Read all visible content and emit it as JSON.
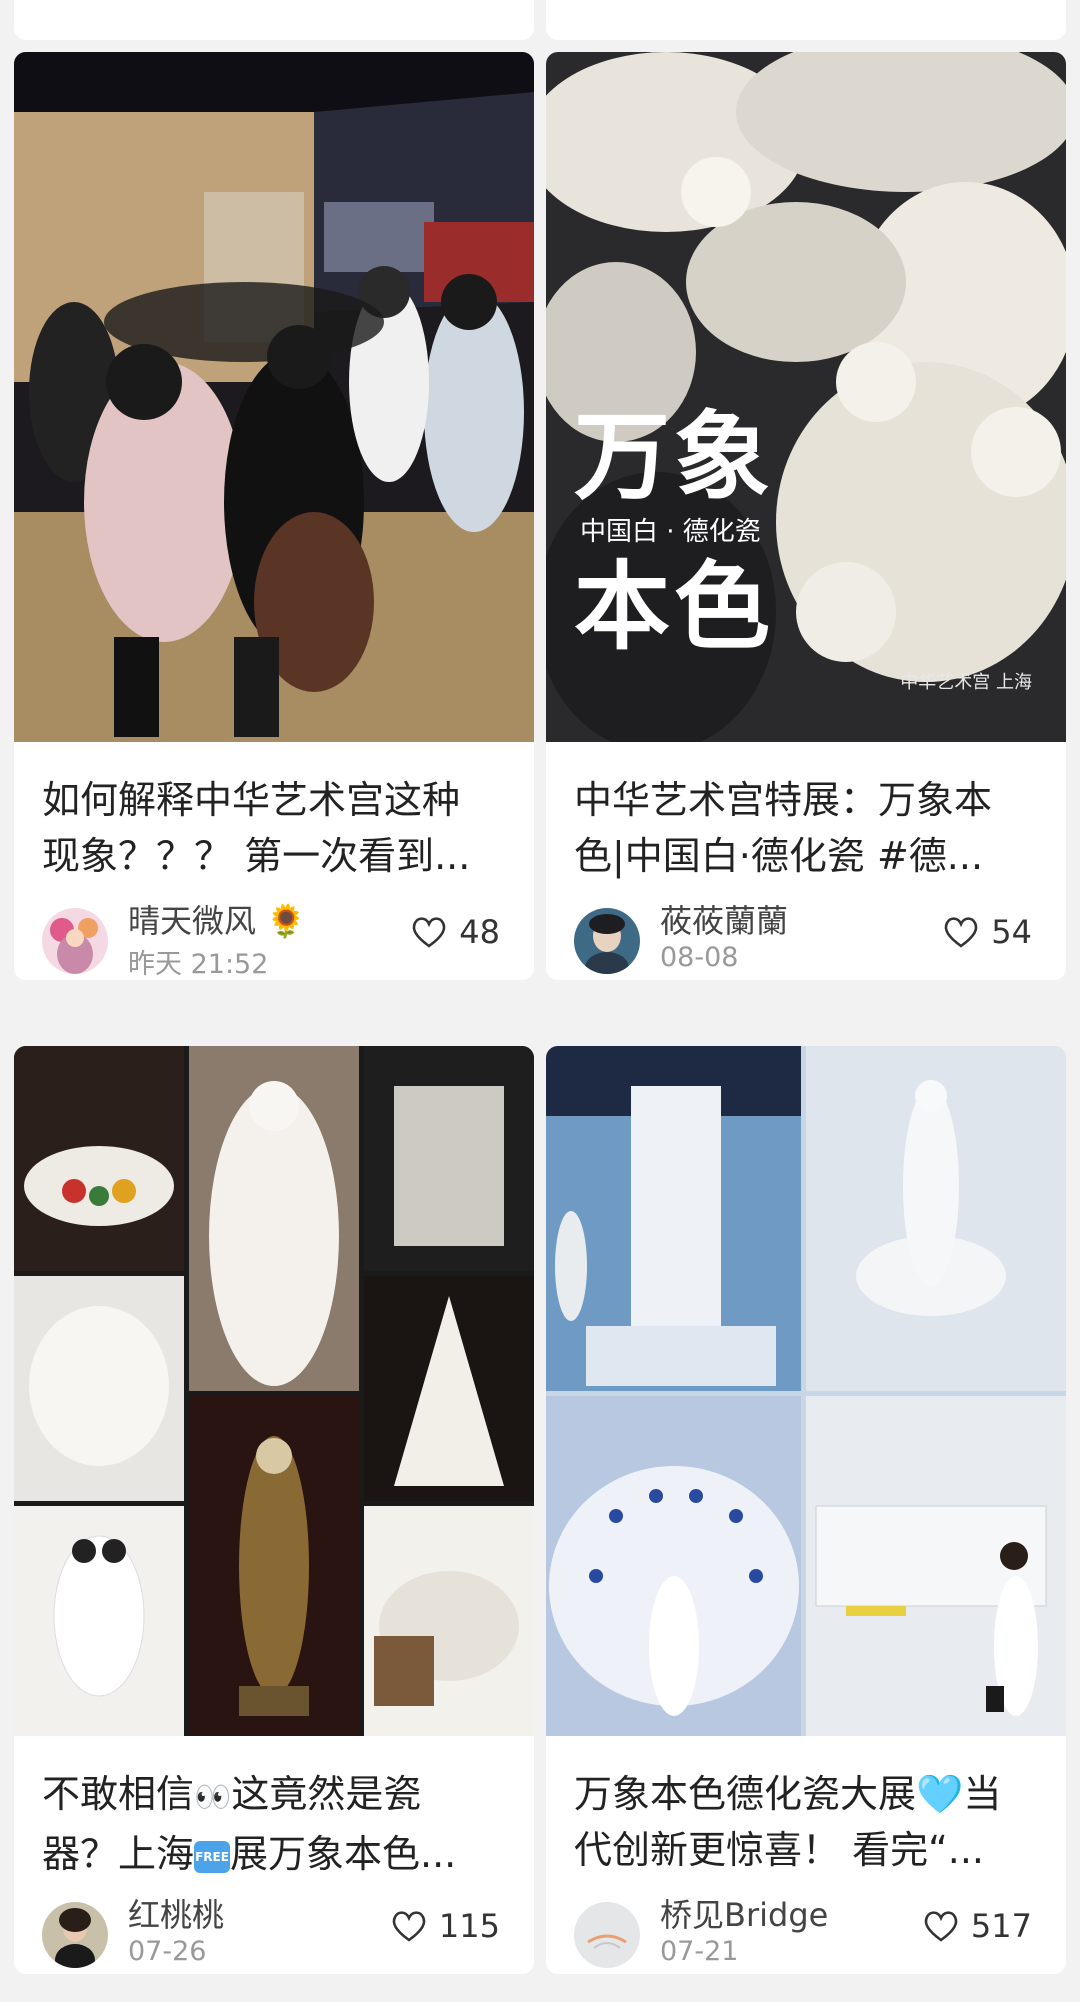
{
  "feed": {
    "cards": [
      {
        "title_line1": "如何解释中华艺术宫这种",
        "title_line2": "现象？？？ 第一次看到...",
        "author": "晴天微风",
        "author_suffix": "🌻",
        "date": "昨天 21:52",
        "likes": "48",
        "image": "museum-crowd-photo"
      },
      {
        "title_line1": "中华艺术宫特展：万象本",
        "title_line2": "色|中国白·德化瓷 #德...",
        "author": "莜莜蘭蘭",
        "date": "08-08",
        "likes": "54",
        "image": "porcelain-flowers-poster",
        "poster": {
          "big_top": "万象",
          "subtitle": "中国白 · 德化瓷",
          "big_bottom": "本色",
          "caption": "中华艺术宫 上海"
        }
      },
      {
        "title_prefix": "不敢相信",
        "title_eyes": "👀",
        "title_rest1": "这竟然是瓷",
        "title_line2_a": "器？上海",
        "title_badge": "FREE",
        "title_line2_b": "展万象本色...",
        "author": "红桃桃",
        "date": "07-26",
        "likes": "115",
        "image": "porcelain-collage"
      },
      {
        "title_line1_a": "万象本色德化瓷大展",
        "title_heart": "🩵",
        "title_line1_b": "当",
        "title_line2": "代创新更惊喜！ 看完“...",
        "author": "桥见Bridge",
        "date": "07-21",
        "likes": "517",
        "image": "exhibition-collage"
      }
    ]
  },
  "colors": {
    "background": "#f2f2f2",
    "card": "#ffffff",
    "title_text": "#222222",
    "meta_text": "#999999"
  }
}
